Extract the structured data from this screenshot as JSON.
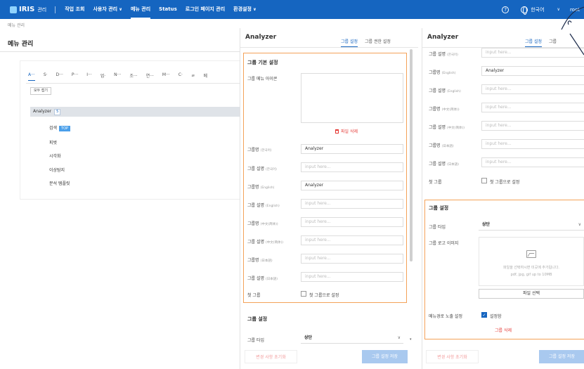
{
  "header": {
    "logo": "IRIS",
    "logo_sub": "관리",
    "nav": [
      {
        "label": "작업 조회",
        "dropdown": false,
        "active": false
      },
      {
        "label": "사용자 관리",
        "dropdown": true,
        "active": false
      },
      {
        "label": "메뉴 관리",
        "dropdown": false,
        "active": true
      },
      {
        "label": "Status",
        "dropdown": false,
        "active": false
      },
      {
        "label": "로그인 페이지 관리",
        "dropdown": false,
        "active": false
      },
      {
        "label": "환경설정",
        "dropdown": true,
        "active": false
      }
    ],
    "help_icon": "?",
    "language": "한국어",
    "user": "root"
  },
  "breadcrumb": "메뉴 관리",
  "page_title": "메뉴 관리",
  "alpha_tabs": [
    "A···",
    "S·",
    "D···",
    "P···",
    "I···",
    "업·",
    "N···",
    "조···",
    "연···",
    "M···",
    "C·",
    "ㄹ",
    "메"
  ],
  "collapse_all": "모두 접기",
  "menu_group": {
    "name": "Analyzer",
    "count": "5"
  },
  "menu_items": [
    {
      "label": "검색",
      "badge": "TOP"
    },
    {
      "label": "피벗",
      "badge": ""
    },
    {
      "label": "시각화",
      "badge": ""
    },
    {
      "label": "이상탐지",
      "badge": ""
    },
    {
      "label": "분석 템플릿",
      "badge": ""
    }
  ],
  "panel1": {
    "title": "Analyzer",
    "tabs": [
      "그룹 설정",
      "그룹 권한 설정"
    ],
    "section_basic": "그룹 기본 설정",
    "icon_label": "그룹 메뉴 아이콘",
    "delete_file": "파일 삭제",
    "fields": [
      {
        "label": "그룹명",
        "sub": "(한국어)",
        "value": "Analyzer"
      },
      {
        "label": "그룹 설명",
        "sub": "(한국어)",
        "value": "input here..."
      },
      {
        "label": "그룹명",
        "sub": "(English)",
        "value": "Analyzer"
      },
      {
        "label": "그룹 설명",
        "sub": "(English)",
        "value": "input here..."
      },
      {
        "label": "그룹명",
        "sub": "(中文(简体))",
        "value": "input here..."
      },
      {
        "label": "그룹 설명",
        "sub": "(中文(简体))",
        "value": "input here..."
      },
      {
        "label": "그룹명",
        "sub": "(日本語)",
        "value": "input here..."
      },
      {
        "label": "그룹 설명",
        "sub": "(日本語)",
        "value": "input here..."
      }
    ],
    "first_group_label": "첫 그룹",
    "first_group_checkbox": "첫 그룹으로 설정",
    "section_group": "그룹 설정",
    "group_type_label": "그룹 타입",
    "group_type_value": "상단",
    "reset_btn": "변경 사항 초기화",
    "save_btn": "그룹 설정 저장"
  },
  "panel2": {
    "title": "Analyzer",
    "tabs": [
      "그룹 설정",
      "그룹"
    ],
    "fields": [
      {
        "label": "그룹 설명",
        "sub": "(한국어)",
        "value": "input here..."
      },
      {
        "label": "그룹명",
        "sub": "(English)",
        "value": "Analyzer"
      },
      {
        "label": "그룹 설명",
        "sub": "(English)",
        "value": "input here..."
      },
      {
        "label": "그룹명",
        "sub": "(中文(简体))",
        "value": "input here..."
      },
      {
        "label": "그룹 설명",
        "sub": "(中文(简体))",
        "value": "input here..."
      },
      {
        "label": "그룹명",
        "sub": "(日本語)",
        "value": "input here..."
      },
      {
        "label": "그룹 설명",
        "sub": "(日本語)",
        "value": "input here..."
      }
    ],
    "first_group_label": "첫 그룹",
    "first_group_checkbox": "첫 그룹으로 설정",
    "section_group": "그룹 설정",
    "group_type_label": "그룹 타입",
    "group_type_value": "상단",
    "logo_label": "그룹 로고 이미지",
    "upload_hint1": "파일을 선택하시면 미곳에 추가됩니다.",
    "upload_hint2": "pdf, jpg, gif up to 10MB",
    "choose_file": "파일 선택",
    "nav_expose_label": "메뉴경로 노출 설정",
    "nav_expose_checkbox": "설정함",
    "delete_group": "그룹 삭제",
    "reset_btn": "변경 사항 초기화",
    "save_btn": "그룹 설정 저장"
  },
  "colors": {
    "primary": "#1565c0",
    "highlight": "#f4a259",
    "danger": "#e53935"
  }
}
